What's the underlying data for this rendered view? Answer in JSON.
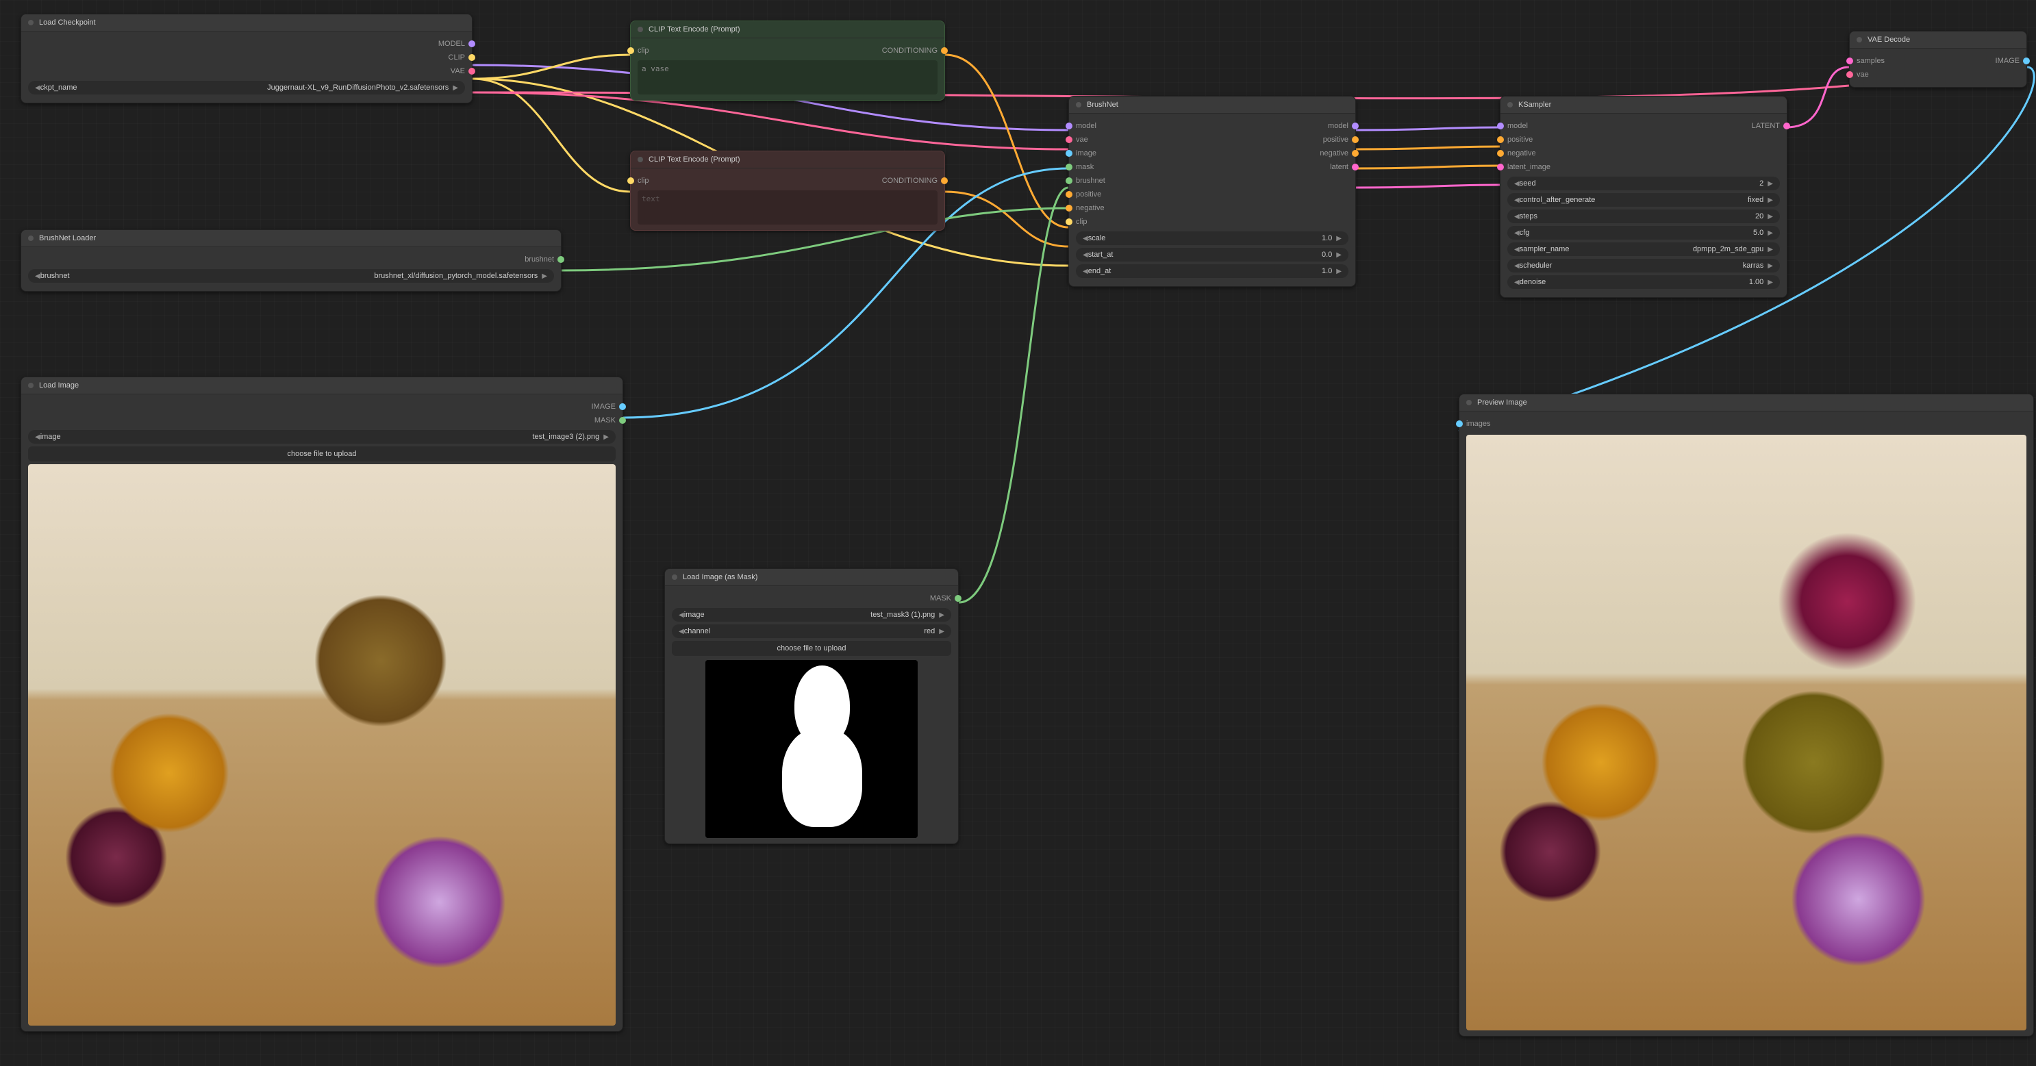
{
  "nodes": {
    "load_checkpoint": {
      "title": "Load Checkpoint",
      "outputs": {
        "model": "MODEL",
        "clip": "CLIP",
        "vae": "VAE"
      },
      "ckpt_label": "ckpt_name",
      "ckpt_value": "Juggernaut-XL_v9_RunDiffusionPhoto_v2.safetensors"
    },
    "brushnet_loader": {
      "title": "BrushNet Loader",
      "outputs": {
        "brushnet": "brushnet"
      },
      "field_label": "brushnet",
      "field_value": "brushnet_xl/diffusion_pytorch_model.safetensors"
    },
    "load_image": {
      "title": "Load Image",
      "outputs": {
        "image": "IMAGE",
        "mask": "MASK"
      },
      "file_label": "image",
      "file_value": "test_image3 (2).png",
      "upload_btn": "choose file to upload"
    },
    "clip_pos": {
      "title": "CLIP Text Encode (Prompt)",
      "input": "clip",
      "output": "CONDITIONING",
      "text": "a vase"
    },
    "clip_neg": {
      "title": "CLIP Text Encode (Prompt)",
      "input": "clip",
      "output": "CONDITIONING",
      "placeholder": "text"
    },
    "load_mask": {
      "title": "Load Image (as Mask)",
      "output": "MASK",
      "file_label": "image",
      "file_value": "test_mask3 (1).png",
      "channel_label": "channel",
      "channel_value": "red",
      "upload_btn": "choose file to upload"
    },
    "brushnet": {
      "title": "BrushNet",
      "inputs": [
        "model",
        "vae",
        "image",
        "mask",
        "brushnet",
        "positive",
        "negative",
        "clip"
      ],
      "outputs": [
        "model",
        "positive",
        "negative",
        "latent"
      ],
      "scale_label": "scale",
      "scale_value": "1.0",
      "start_label": "start_at",
      "start_value": "0.0",
      "end_label": "end_at",
      "end_value": "1.0"
    },
    "ksampler": {
      "title": "KSampler",
      "inputs": [
        "model",
        "positive",
        "negative",
        "latent_image"
      ],
      "output": "LATENT",
      "seed_label": "seed",
      "seed_value": "2",
      "ctrl_label": "control_after_generate",
      "ctrl_value": "fixed",
      "steps_label": "steps",
      "steps_value": "20",
      "cfg_label": "cfg",
      "cfg_value": "5.0",
      "sampler_label": "sampler_name",
      "sampler_value": "dpmpp_2m_sde_gpu",
      "sched_label": "scheduler",
      "sched_value": "karras",
      "denoise_label": "denoise",
      "denoise_value": "1.00"
    },
    "vae_decode": {
      "title": "VAE Decode",
      "inputs": [
        "samples",
        "vae"
      ],
      "output": "IMAGE"
    },
    "preview": {
      "title": "Preview Image",
      "input": "images"
    }
  },
  "colors": {
    "model": "#b28cff",
    "clip": "#ffd966",
    "vae": "#ff6699",
    "image": "#66ccff",
    "mask": "#7ecb7e",
    "conditioning": "#ffaa33",
    "latent": "#ff66cc",
    "brushnet": "#7ecb7e"
  }
}
